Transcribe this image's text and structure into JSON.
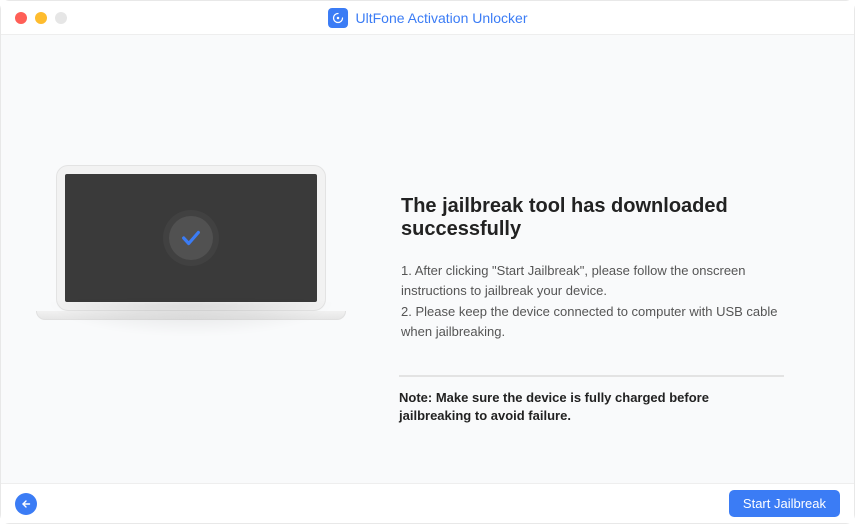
{
  "window": {
    "title": "UltFone Activation Unlocker"
  },
  "main": {
    "headline": "The jailbreak tool has downloaded successfully",
    "instruction_1": "1. After clicking \"Start Jailbreak\", please follow the onscreen instructions to jailbreak your device.",
    "instruction_2": "2. Please keep the device connected to computer with USB cable when jailbreaking.",
    "note": "Note: Make sure the device is fully charged before jailbreaking to avoid failure."
  },
  "footer": {
    "primary_button": "Start Jailbreak"
  }
}
